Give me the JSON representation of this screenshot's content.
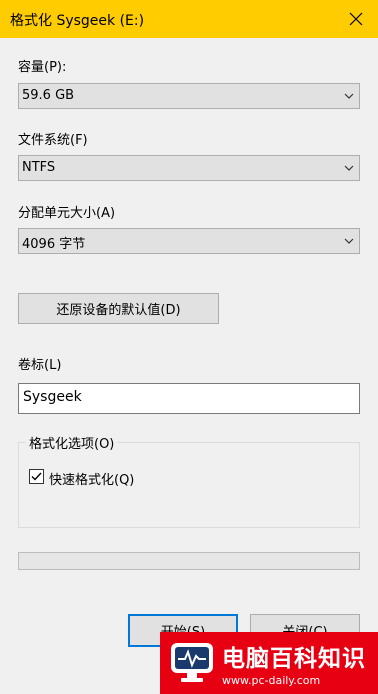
{
  "window": {
    "title": "格式化 Sysgeek (E:)"
  },
  "capacity": {
    "label": "容量(P):",
    "value": "59.6 GB"
  },
  "filesystem": {
    "label": "文件系统(F)",
    "value": "NTFS"
  },
  "allocation": {
    "label": "分配单元大小(A)",
    "value": "4096 字节"
  },
  "restore_defaults_label": "还原设备的默认值(D)",
  "volume": {
    "label": "卷标(L)",
    "value": "Sysgeek"
  },
  "options": {
    "legend": "格式化选项(O)",
    "quick_format": {
      "label": "快速格式化(Q)",
      "checked": true
    }
  },
  "progress": {
    "value": 0
  },
  "buttons": {
    "start": "开始(S)",
    "close": "关闭(C)"
  },
  "watermark": {
    "title": "电脑百科知识",
    "url": "www.pc-daily.com"
  },
  "colors": {
    "titlebar": "#ffcc00",
    "watermark": "#e60012",
    "focus": "#0078d7"
  }
}
